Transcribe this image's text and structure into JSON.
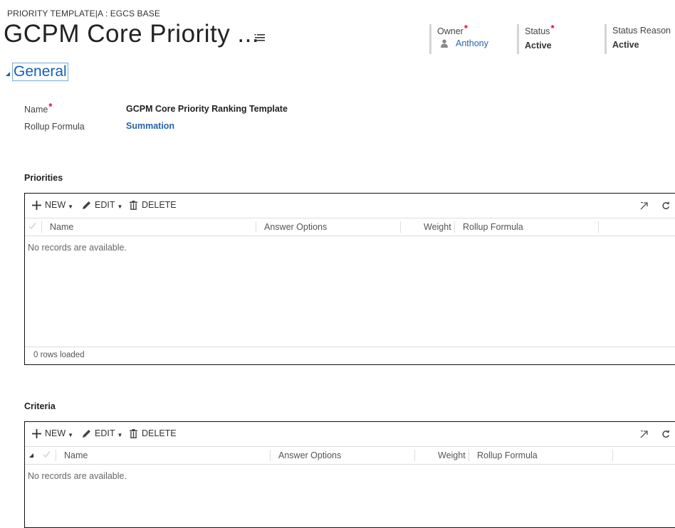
{
  "header": {
    "entity_type": "PRIORITY TEMPLATE|A : EGCS BASE",
    "record_title": "GCPM Core Priority ...",
    "fields": {
      "owner": {
        "label": "Owner",
        "required": "*",
        "value": "Anthony"
      },
      "status": {
        "label": "Status",
        "required": "*",
        "value": "Active"
      },
      "status_reason": {
        "label": "Status Reason",
        "value": "Active"
      }
    }
  },
  "section": {
    "title": "General",
    "fields": {
      "name": {
        "label": "Name",
        "required": "*",
        "value": "GCPM Core Priority Ranking Template"
      },
      "rollup_formula": {
        "label": "Rollup Formula",
        "value": "Summation"
      }
    }
  },
  "commands": {
    "new": "NEW",
    "edit": "EDIT",
    "delete": "DELETE"
  },
  "columns": {
    "name": "Name",
    "answer_options": "Answer Options",
    "weight": "Weight",
    "rollup_formula": "Rollup Formula"
  },
  "subgrids": {
    "priorities": {
      "title": "Priorities",
      "empty_message": "No records are available.",
      "footer": "0 rows loaded"
    },
    "criteria": {
      "title": "Criteria",
      "empty_message": "No records are available."
    }
  },
  "colors": {
    "accent": "#1160b7",
    "link": "#2762ac",
    "required": "#e4002b",
    "border": "#111111"
  },
  "icons": [
    "menu-lines-icon",
    "person-icon",
    "collapse-triangle-icon",
    "plus-icon",
    "pencil-icon",
    "trash-icon",
    "expand-icon",
    "refresh-icon",
    "checkmark-icon",
    "sort-triangle-icon"
  ]
}
